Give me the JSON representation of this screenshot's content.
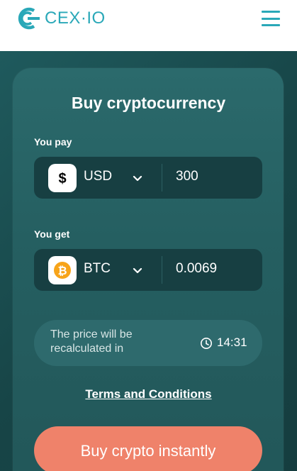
{
  "header": {
    "logo_text": "CEX·IO",
    "logo_icon": "cex-logo-icon",
    "menu_icon": "hamburger-menu-icon",
    "brand_color": "#2aa8b8"
  },
  "form": {
    "title": "Buy cryptocurrency",
    "pay": {
      "label": "You pay",
      "currency": "USD",
      "currency_icon": "dollar-icon",
      "amount": "300"
    },
    "get": {
      "label": "You get",
      "currency": "BTC",
      "currency_icon": "bitcoin-icon",
      "amount": "0.0069"
    },
    "recalc": {
      "text": "The price will be recalculated in",
      "time": "14:31",
      "icon": "clock-icon"
    },
    "terms_link": "Terms and Conditions",
    "buy_button": "Buy crypto instantly",
    "accent_color": "#ef826a"
  }
}
